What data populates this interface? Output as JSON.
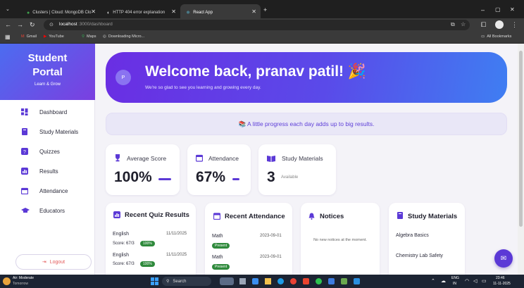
{
  "browser": {
    "tabs": [
      {
        "label": "Clusters | Cloud: MongoDB Clo",
        "active": false
      },
      {
        "label": "HTTP 404 error explanation",
        "active": false
      },
      {
        "label": "React App",
        "active": true
      }
    ],
    "url_host": "localhost",
    "url_path": ":3000/dashboard",
    "bookmarks": [
      "Gmail",
      "YouTube",
      "Maps",
      "Downloading Micro..."
    ],
    "all_bookmarks": "All Bookmarks"
  },
  "sidebar": {
    "brand_line1": "Student",
    "brand_line2": "Portal",
    "brand_tagline": "Learn & Grow",
    "items": [
      {
        "label": "Dashboard",
        "icon": "grid-icon"
      },
      {
        "label": "Study Materials",
        "icon": "book-icon"
      },
      {
        "label": "Quizzes",
        "icon": "question-icon"
      },
      {
        "label": "Results",
        "icon": "chart-icon"
      },
      {
        "label": "Attendance",
        "icon": "calendar-icon"
      },
      {
        "label": "Educators",
        "icon": "graduation-cap-icon"
      }
    ],
    "logout_label": "Logout"
  },
  "hero": {
    "avatar_initial": "P",
    "title": "Welcome back, pranav patil! 🎉",
    "subtitle": "We're so glad to see you learning and growing every day."
  },
  "quote": "📚 A little progress each day adds up to big results.",
  "stats": [
    {
      "label": "Average Score",
      "value": "100%",
      "icon": "trophy-icon"
    },
    {
      "label": "Attendance",
      "value": "67%",
      "icon": "calendar-icon"
    },
    {
      "label": "Study Materials",
      "value": "3",
      "suffix": "Available",
      "icon": "book-open-icon"
    }
  ],
  "quiz_results": {
    "title": "Recent Quiz Results",
    "items": [
      {
        "subject": "English",
        "date": "11/11/2025",
        "score": "Score: 67/3",
        "badge": "100%"
      },
      {
        "subject": "English",
        "date": "11/11/2025",
        "score": "Score: 67/3",
        "badge": "100%"
      }
    ]
  },
  "recent_attendance": {
    "title": "Recent Attendance",
    "items": [
      {
        "subject": "Math",
        "date": "2023-09-01",
        "status": "Present"
      },
      {
        "subject": "Math",
        "date": "2023-09-01",
        "status": "Present"
      }
    ]
  },
  "notices": {
    "title": "Notices",
    "empty_text": "No new notices at the moment."
  },
  "study_materials": {
    "title": "Study Materials",
    "items": [
      "Algebra Basics",
      "Chemistry Lab Safety"
    ]
  },
  "taskbar": {
    "weather_title": "Air: Moderate",
    "weather_sub": "Tomorrow",
    "search": "Search",
    "lang_line1": "ENG",
    "lang_line2": "IN",
    "time": "23:46",
    "date": "11-11-2025"
  },
  "colors": {
    "accent": "#5b39d6",
    "hero_start": "#6a2ee3",
    "hero_end": "#3f7ef2",
    "success": "#2f8a3c",
    "danger": "#e35a5a"
  }
}
